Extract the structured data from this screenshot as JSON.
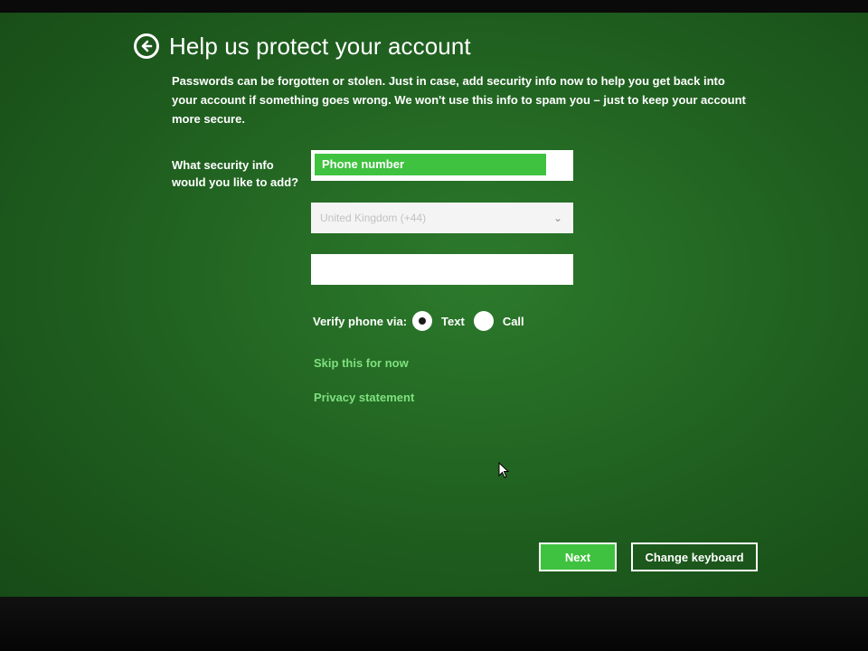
{
  "header": {
    "title": "Help us protect your account",
    "intro": "Passwords can be forgotten or stolen. Just in case, add security info now to help you get back into your account if something goes wrong. We won't use this info to spam you – just to keep your account more secure."
  },
  "form": {
    "security_info_label": "What security info would you like to add?",
    "security_info_selected": "Phone number",
    "country_value": "United Kingdom (+44)",
    "phone_value": "",
    "verify_label": "Verify phone via:",
    "verify_options": [
      "Text",
      "Call"
    ],
    "verify_selected": "Text"
  },
  "links": {
    "skip": "Skip this for now",
    "privacy": "Privacy statement"
  },
  "buttons": {
    "next": "Next",
    "change_keyboard": "Change keyboard"
  },
  "icons": {
    "back": "back-arrow-icon",
    "dropdown": "chevron-down-icon",
    "cursor": "mouse-pointer-icon"
  },
  "colors": {
    "background": "#236b23",
    "accent": "#3fc23f",
    "link": "#7ee07e",
    "text": "#ffffff"
  }
}
